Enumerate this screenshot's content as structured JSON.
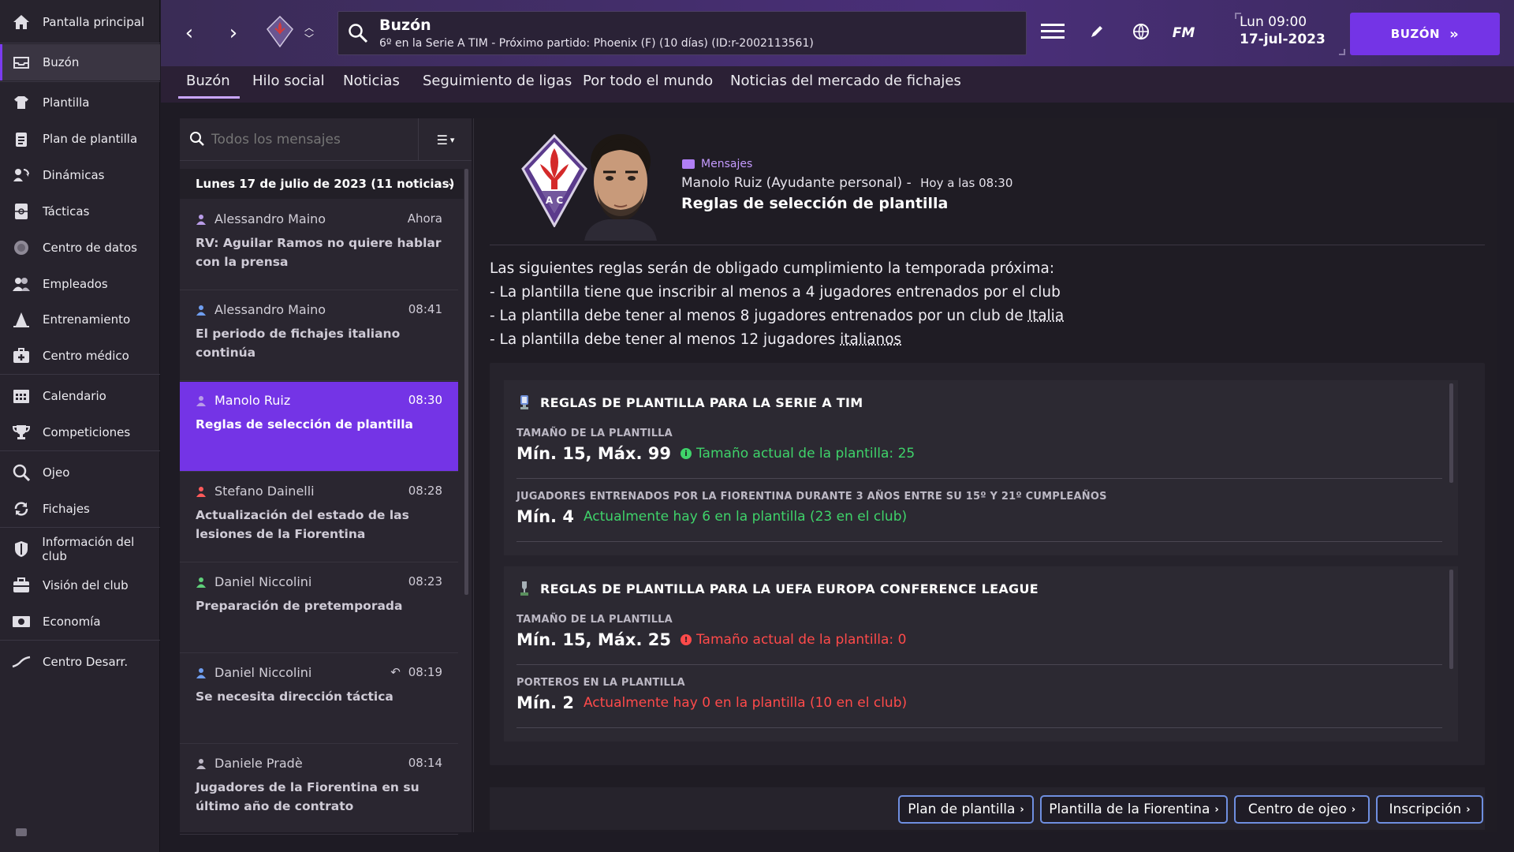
{
  "sidebar": {
    "items": [
      {
        "label": "Pantalla principal",
        "icon": "home-icon"
      },
      {
        "label": "Buzón",
        "icon": "inbox-icon"
      },
      {
        "label": "Plantilla",
        "icon": "shirt-icon"
      },
      {
        "label": "Plan de plantilla",
        "icon": "clipboard-icon"
      },
      {
        "label": "Dinámicas",
        "icon": "dynamics-icon"
      },
      {
        "label": "Tácticas",
        "icon": "tactics-icon"
      },
      {
        "label": "Centro de datos",
        "icon": "data-icon"
      },
      {
        "label": "Empleados",
        "icon": "staff-icon"
      },
      {
        "label": "Entrenamiento",
        "icon": "training-cone-icon"
      },
      {
        "label": "Centro médico",
        "icon": "medical-icon"
      },
      {
        "label": "Calendario",
        "icon": "calendar-icon"
      },
      {
        "label": "Competiciones",
        "icon": "trophy-icon"
      },
      {
        "label": "Ojeo",
        "icon": "scout-search-icon"
      },
      {
        "label": "Fichajes",
        "icon": "transfer-icon"
      },
      {
        "label": "Información del club",
        "icon": "shield-icon"
      },
      {
        "label": "Visión del club",
        "icon": "briefcase-icon"
      },
      {
        "label": "Economía",
        "icon": "finance-icon"
      },
      {
        "label": "Centro Desarr.",
        "icon": "development-icon"
      }
    ]
  },
  "topbar": {
    "title": "Buzón",
    "subtitle": "6º en la Serie A TIM - Próximo partido: Phoenix (F) (10 días) (ID:r-2002113561)",
    "date_line1": "Lun 09:00",
    "date_line2": "17-jul-2023",
    "fm_label": "FM",
    "continue_label": "BUZÓN"
  },
  "tabs": [
    {
      "label": "Buzón"
    },
    {
      "label": "Hilo social"
    },
    {
      "label": "Noticias"
    },
    {
      "label": "Seguimiento de ligas"
    },
    {
      "label": "Por todo el mundo"
    },
    {
      "label": "Noticias del mercado de fichajes"
    }
  ],
  "inbox": {
    "search_placeholder": "Todos los mensajes",
    "day_header": "Lunes 17 de julio de 2023 (11 noticias)",
    "messages": [
      {
        "sender": "Alessandro Maino",
        "time": "Ahora",
        "subject": "RV: Aguilar Ramos no quiere hablar con la prensa",
        "icon_color": "#b99ce8"
      },
      {
        "sender": "Alessandro Maino",
        "time": "08:41",
        "subject": "El periodo de fichajes italiano continúa",
        "icon_color": "#6f9ef0"
      },
      {
        "sender": "Manolo Ruiz",
        "time": "08:30",
        "subject": "Reglas de selección de plantilla",
        "icon_color": "#b99ce8"
      },
      {
        "sender": "Stefano Dainelli",
        "time": "08:28",
        "subject": "Actualización del estado de las lesiones de la Fiorentina",
        "icon_color": "#ff5a5a"
      },
      {
        "sender": "Daniel Niccolini",
        "time": "08:23",
        "subject": "Preparación de pretemporada",
        "icon_color": "#5fcf7a"
      },
      {
        "sender": "Daniel Niccolini",
        "time": "08:19",
        "subject": "Se necesita dirección táctica",
        "icon_color": "#6f9ef0"
      },
      {
        "sender": "Daniele Pradè",
        "time": "08:14",
        "subject": "Jugadores de la Fiorentina en su último año de contrato",
        "icon_color": "#bdb8c6"
      }
    ]
  },
  "detail": {
    "category": "Mensajes",
    "from": "Manolo Ruiz (Ayudante personal)",
    "separator": "-",
    "when": "Hoy a las 08:30",
    "subject": "Reglas de selección de plantilla",
    "body_intro": "Las siguientes reglas serán de obligado cumplimiento la temporada próxima:",
    "body_l1": "- La plantilla tiene que inscribir al menos a 4 jugadores entrenados por el club",
    "body_l2_a": "- La plantilla debe tener al menos 8 jugadores entrenados por un club de ",
    "body_l2_link": "Italia",
    "body_l3_a": "- La plantilla debe tener al menos 12 jugadores ",
    "body_l3_link": "italianos",
    "rules": [
      {
        "title": "REGLAS DE PLANTILLA PARA LA SERIE A TIM",
        "rows": [
          {
            "label": "TAMAÑO DE LA PLANTILLA",
            "value": "Mín. 15, Máx. 99",
            "note": "Tamaño actual de la plantilla: 25",
            "status": "ok"
          },
          {
            "label": "JUGADORES ENTRENADOS POR LA FIORENTINA DURANTE 3 AÑOS ENTRE SU 15º Y 21º CUMPLEAÑOS",
            "value": "Mín. 4",
            "note": "Actualmente hay 6 en la plantilla (23 en el club)",
            "status": "ok"
          }
        ]
      },
      {
        "title": "REGLAS DE PLANTILLA PARA LA UEFA EUROPA CONFERENCE LEAGUE",
        "rows": [
          {
            "label": "TAMAÑO DE LA PLANTILLA",
            "value": "Mín. 15, Máx. 25",
            "note": "Tamaño actual de la plantilla: 0",
            "status": "bad"
          },
          {
            "label": "PORTEROS EN LA PLANTILLA",
            "value": "Mín. 2",
            "note": "Actualmente hay 0 en la plantilla (10 en el club)",
            "status": "bad"
          }
        ]
      }
    ],
    "buttons": [
      {
        "label": "Plan de plantilla"
      },
      {
        "label": "Plantilla de la Fiorentina"
      },
      {
        "label": "Centro de ojeo"
      },
      {
        "label": "Inscripción"
      }
    ]
  },
  "colors": {
    "accent": "#7434e6",
    "ok": "#3fd36a",
    "bad": "#ff4a4a",
    "button_border": "#6f8fe0"
  }
}
